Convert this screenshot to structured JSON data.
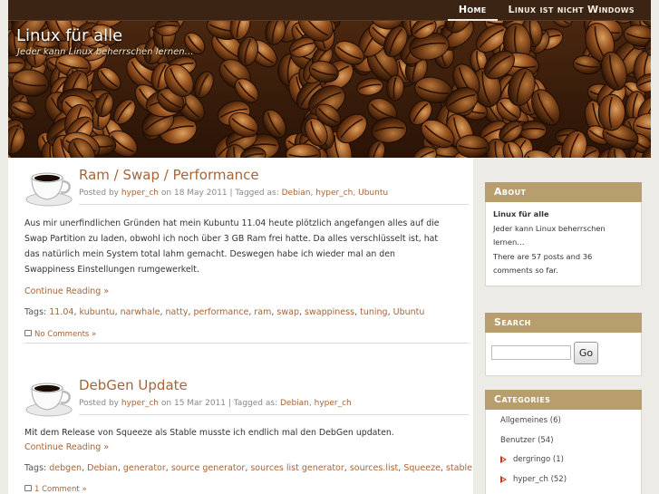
{
  "nav": {
    "items": [
      {
        "label": "Home",
        "active": true
      },
      {
        "label": "Linux ist nicht Windows",
        "active": false
      }
    ]
  },
  "site": {
    "title": "Linux für alle",
    "tagline": "Jeder kann Linux beherrschen lernen…"
  },
  "posts": [
    {
      "title": "Ram / Swap / Performance",
      "meta_prefix": "Posted by",
      "author": "hyper_ch",
      "meta_on": "on",
      "date": "18 May 2011",
      "tagged_as": "| Tagged as:",
      "meta_tags": [
        "Debian",
        "hyper_ch",
        "Ubuntu"
      ],
      "body": "Aus mir unerfindlichen Gründen hat mein Kubuntu 11.04 heute plötzlich angefangen alles auf die Swap Partition zu laden, obwohl ich noch über 3 GB Ram frei hatte. Da alles verschlüsselt ist, hat das natürlich mein System total lahm gemacht. Deswegen habe ich wieder mal an den Swappiness Einstellungen rumgewerkelt.",
      "continue": "Continue Reading »",
      "tags_label": "Tags:",
      "tags": [
        "11.04",
        "kubuntu",
        "narwhale",
        "natty",
        "performance",
        "ram",
        "swap",
        "swappiness",
        "tuning",
        "Ubuntu"
      ],
      "comments": "No Comments »"
    },
    {
      "title": "DebGen Update",
      "meta_prefix": "Posted by",
      "author": "hyper_ch",
      "meta_on": "on",
      "date": "15 Mar 2011",
      "tagged_as": "| Tagged as:",
      "meta_tags": [
        "Debian",
        "hyper_ch"
      ],
      "body": "Mit dem Release von Squeeze als Stable musste ich endlich mal den DebGen updaten.",
      "continue": "Continue Reading »",
      "tags_label": "Tags:",
      "tags": [
        "debgen",
        "Debian",
        "generator",
        "source generator",
        "sources list generator",
        "sources.list",
        "Squeeze",
        "stable"
      ],
      "comments": "1 Comment »"
    }
  ],
  "sidebar": {
    "about": {
      "heading": "About",
      "site_name": "Linux für alle",
      "line1": "Jeder kann Linux beherrschen lernen…",
      "line2": "There are 57 posts and 36 comments so far."
    },
    "search": {
      "heading": "Search",
      "value": "",
      "button": "Go"
    },
    "categories": {
      "heading": "Categories",
      "items": [
        {
          "name": "Allgemeines",
          "count": "(6)",
          "sub": false
        },
        {
          "name": "Benutzer",
          "count": "(54)",
          "sub": false
        },
        {
          "name": "dergringo",
          "count": "(1)",
          "sub": true
        },
        {
          "name": "hyper_ch",
          "count": "(52)",
          "sub": true
        }
      ]
    }
  },
  "colors": {
    "accent": "#a4653a",
    "widget_header": "#b79e6c",
    "topbar": "#3b2414",
    "bullet": "#c0392b"
  },
  "icons": [
    "coffee-cup-icon",
    "comment-icon",
    "arrow-bullet-icon"
  ]
}
